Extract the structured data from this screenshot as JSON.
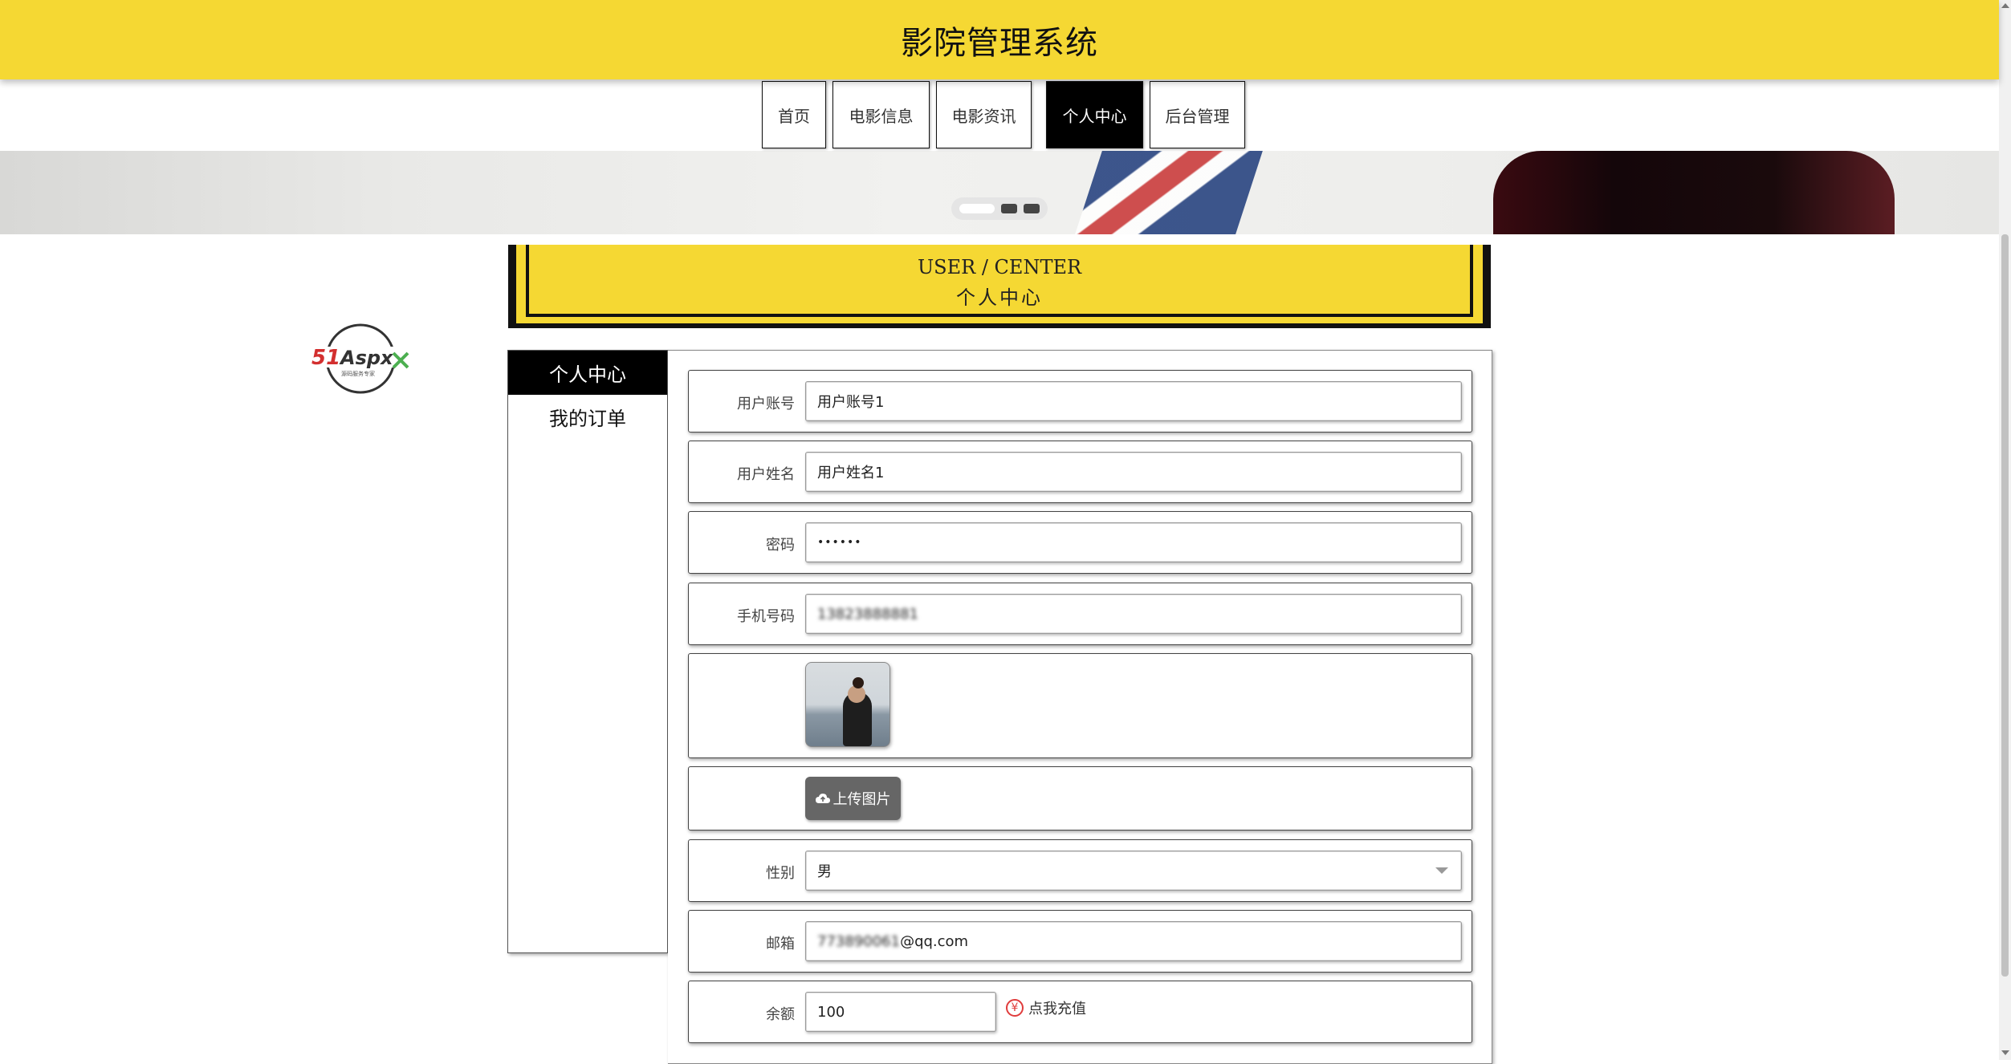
{
  "header": {
    "title": "影院管理系统"
  },
  "nav": [
    {
      "label": "首页",
      "active": false
    },
    {
      "label": "电影信息",
      "active": false
    },
    {
      "label": "电影资讯",
      "active": false
    },
    {
      "label": "个人中心",
      "active": true
    },
    {
      "label": "后台管理",
      "active": false
    }
  ],
  "carousel": {
    "slides": 3,
    "active_index": 0
  },
  "section_title": {
    "en": "USER / CENTER",
    "cn": "个人中心"
  },
  "logo": {
    "text": "51Aspx",
    "subtext": "源码服务专家"
  },
  "sidebar": {
    "items": [
      {
        "label": "个人中心",
        "active": true
      },
      {
        "label": "我的订单",
        "active": false
      }
    ]
  },
  "form": {
    "account": {
      "label": "用户账号",
      "value": "用户账号1"
    },
    "name": {
      "label": "用户姓名",
      "value": "用户姓名1"
    },
    "password": {
      "label": "密码",
      "value": "••••••"
    },
    "phone": {
      "label": "手机号码",
      "value": "13823888881"
    },
    "avatar": {
      "label": ""
    },
    "upload": {
      "label": "上传图片"
    },
    "gender": {
      "label": "性别",
      "value": "男"
    },
    "email": {
      "label": "邮箱",
      "value_masked": "773890061",
      "value_domain": "@qq.com"
    },
    "balance": {
      "label": "余额",
      "value": "100",
      "recharge_label": "点我充值"
    }
  },
  "colors": {
    "brand_yellow": "#f5d833",
    "black": "#000000",
    "danger_red": "#e03c3c"
  }
}
